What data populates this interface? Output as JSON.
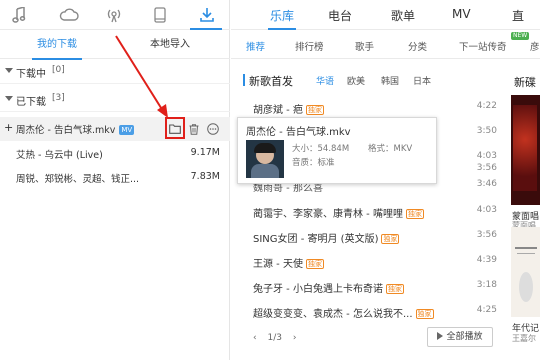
{
  "left": {
    "top_icons": [
      "music-note-icon",
      "cloud-icon",
      "radio-icon",
      "phone-icon",
      "download-icon"
    ],
    "tabs": [
      {
        "label": "我的下载",
        "active": true
      },
      {
        "label": "本地导入",
        "active": false
      }
    ],
    "downloading": {
      "label": "下载中",
      "count": "[0]"
    },
    "downloaded": {
      "label": "已下载",
      "count": "[3]"
    },
    "items": [
      {
        "plus": "+",
        "name": "周杰伦 - 告白气球.mkv",
        "badge": "MV",
        "size": ""
      },
      {
        "name": "艾热 - 乌云中 (Live)",
        "size": "9.17M"
      },
      {
        "name": "周锐、郑锐彬、灵超、钱正...",
        "size": "7.83M"
      }
    ]
  },
  "right": {
    "nav": [
      {
        "label": "乐库",
        "active": true
      },
      {
        "label": "电台",
        "active": false
      },
      {
        "label": "歌单",
        "active": false
      },
      {
        "label": "MV",
        "active": false
      },
      {
        "label": "直",
        "active": false
      }
    ],
    "subnav": [
      {
        "label": "推荐",
        "active": true
      },
      {
        "label": "排行榜",
        "active": false
      },
      {
        "label": "歌手",
        "active": false
      },
      {
        "label": "分类",
        "active": false
      },
      {
        "label": "下一站传奇",
        "active": false
      },
      {
        "label": "彦",
        "active": false
      }
    ],
    "new_badge": "NEW",
    "section_title": "新歌首发",
    "regions": [
      {
        "label": "华语",
        "active": true
      },
      {
        "label": "欧美",
        "active": false
      },
      {
        "label": "韩国",
        "active": false
      },
      {
        "label": "日本",
        "active": false
      }
    ],
    "songs": [
      {
        "name": "胡彦斌 - 疤",
        "tag": "独家",
        "time": "4:22"
      },
      {
        "name": "",
        "tag": "",
        "time": "3:50"
      },
      {
        "name": "",
        "tag": "",
        "time": "4:03"
      },
      {
        "name": "",
        "tag": "",
        "time": "3:56"
      },
      {
        "name": "魏雨哥 - 那么喜",
        "tag": "",
        "time": "3:46"
      },
      {
        "name": "蔺霭宇、李家豪、康青林 - 嘴哩哩",
        "tag": "独家",
        "time": "4:03"
      },
      {
        "name": "SING女团 - 寄明月 (英文版)",
        "tag": "独家",
        "time": "3:56"
      },
      {
        "name": "王源 - 天使",
        "tag": "独家",
        "time": "4:39"
      },
      {
        "name": "兔子牙 - 小白兔遇上卡布奇诺",
        "tag": "独家",
        "time": "3:18"
      },
      {
        "name": "超级变变变、袁成杰 - 怎么说我不...",
        "tag": "独家",
        "time": "4:25"
      }
    ],
    "pager": {
      "prev": "‹",
      "page": "1/3",
      "next": "›"
    },
    "play_all": "全部播放",
    "side_title": "新碟",
    "side_items": [
      "蒙面唱",
      "蒙面唱",
      "年代记",
      "王嘉尔"
    ]
  },
  "tooltip": {
    "title": "周杰伦 - 告白气球.mkv",
    "size_label": "大小：54.84M",
    "format_label": "格式：MKV",
    "quality_label": "音质：标准"
  },
  "colors": {
    "accent": "#2b8de3",
    "tag_orange": "#f08a24",
    "annotation_red": "#e0201a"
  }
}
